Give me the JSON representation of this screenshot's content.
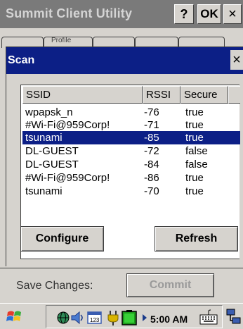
{
  "window": {
    "title": "Summit Client Utility",
    "help_label": "?",
    "ok_label": "OK",
    "close_label": "×"
  },
  "tabs": [
    "Profile",
    "",
    "",
    ""
  ],
  "dialog": {
    "title": "Scan",
    "close_label": "×",
    "columns": [
      "SSID",
      "RSSI",
      "Secure"
    ],
    "rows": [
      {
        "ssid": "wpapsk_n",
        "rssi": "-76",
        "secure": "true"
      },
      {
        "ssid": "#Wi-Fi@959Corp!",
        "rssi": "-71",
        "secure": "true"
      },
      {
        "ssid": "tsunami",
        "rssi": "-85",
        "secure": "true"
      },
      {
        "ssid": "DL-GUEST",
        "rssi": "-72",
        "secure": "false"
      },
      {
        "ssid": "DL-GUEST",
        "rssi": "-84",
        "secure": "false"
      },
      {
        "ssid": "#Wi-Fi@959Corp!",
        "rssi": "-86",
        "secure": "true"
      },
      {
        "ssid": "tsunami",
        "rssi": "-70",
        "secure": "true"
      }
    ],
    "selected_row": 2,
    "configure_label": "Configure",
    "refresh_label": "Refresh"
  },
  "footer": {
    "save_label": "Save Changes:",
    "commit_label": "Commit"
  },
  "taskbar": {
    "time": "5:00 AM",
    "icons": [
      "start-flag-icon",
      "network-globe-icon",
      "speaker-icon",
      "calendar-icon",
      "power-plug-icon",
      "battery-icon",
      "arrow-right-icon",
      "keyboard-icon",
      "connection-icon"
    ]
  },
  "colors": {
    "selection": "#0c1f86",
    "dialog_header": "#0c1f86",
    "title_bar": "#7a7a7a",
    "face": "#d6d3ce"
  }
}
